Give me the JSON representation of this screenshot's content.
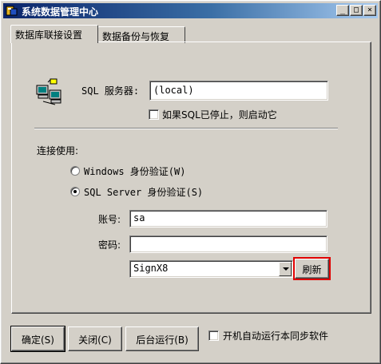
{
  "window": {
    "title": "系统数据管理中心",
    "caption_buttons": {
      "minimize": "_",
      "maximize": "□",
      "close": "×"
    }
  },
  "tabs": [
    {
      "label": "数据库联接设置",
      "active": true
    },
    {
      "label": "数据备份与恢复",
      "active": false
    }
  ],
  "connection": {
    "server_label": "SQL 服务器:",
    "server_value": "(local)",
    "autostart_label": "如果SQL已停止，则启动它",
    "autostart_checked": false,
    "use_label": "连接使用:",
    "auth_windows_label": "Windows 身份验证(W)",
    "auth_sql_label": "SQL Server 身份验证(S)",
    "auth_selected": "sql",
    "account_label": "账号:",
    "account_value": "sa",
    "password_label": "密码:",
    "password_value": "",
    "database_value": "SignX8",
    "refresh_label": "刷新",
    "refresh_highlight_color": "#e00000"
  },
  "footer": {
    "ok_label": "确定(S)",
    "close_label": "关闭(C)",
    "background_label": "后台运行(B)",
    "autorun_label": "开机自动运行本同步软件",
    "autorun_checked": false
  },
  "icons": {
    "app": "app-database-icon",
    "server": "network-computers-icon"
  }
}
